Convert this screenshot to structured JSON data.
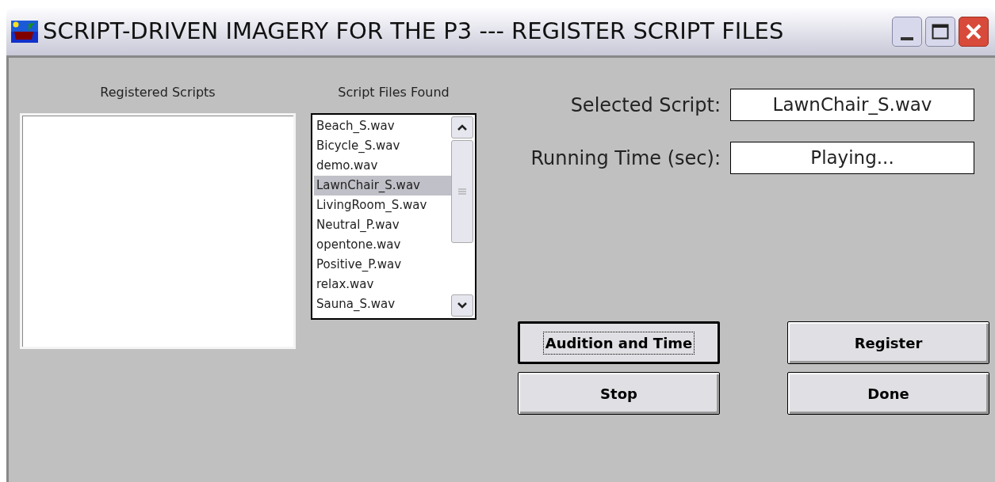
{
  "window": {
    "title": "SCRIPT-DRIVEN IMAGERY FOR THE P3 --- REGISTER SCRIPT FILES"
  },
  "registered": {
    "label": "Registered Scripts"
  },
  "found": {
    "label": "Script Files Found",
    "items": [
      {
        "name": "Beach_S.wav",
        "selected": false
      },
      {
        "name": "Bicycle_S.wav",
        "selected": false
      },
      {
        "name": "demo.wav",
        "selected": false
      },
      {
        "name": "LawnChair_S.wav",
        "selected": true
      },
      {
        "name": "LivingRoom_S.wav",
        "selected": false
      },
      {
        "name": "Neutral_P.wav",
        "selected": false
      },
      {
        "name": "opentone.wav",
        "selected": false
      },
      {
        "name": "Positive_P.wav",
        "selected": false
      },
      {
        "name": "relax.wav",
        "selected": false
      },
      {
        "name": "Sauna_S.wav",
        "selected": false
      }
    ]
  },
  "fields": [
    {
      "label": "Selected Script:",
      "value": "LawnChair_S.wav"
    },
    {
      "label": "Running Time (sec):",
      "value": "Playing..."
    }
  ],
  "buttons": [
    [
      {
        "label": "Audition and Time",
        "focused": true
      },
      {
        "label": "Register",
        "focused": false
      }
    ],
    [
      {
        "label": "Stop",
        "focused": false
      },
      {
        "label": "Done",
        "focused": false
      }
    ]
  ]
}
